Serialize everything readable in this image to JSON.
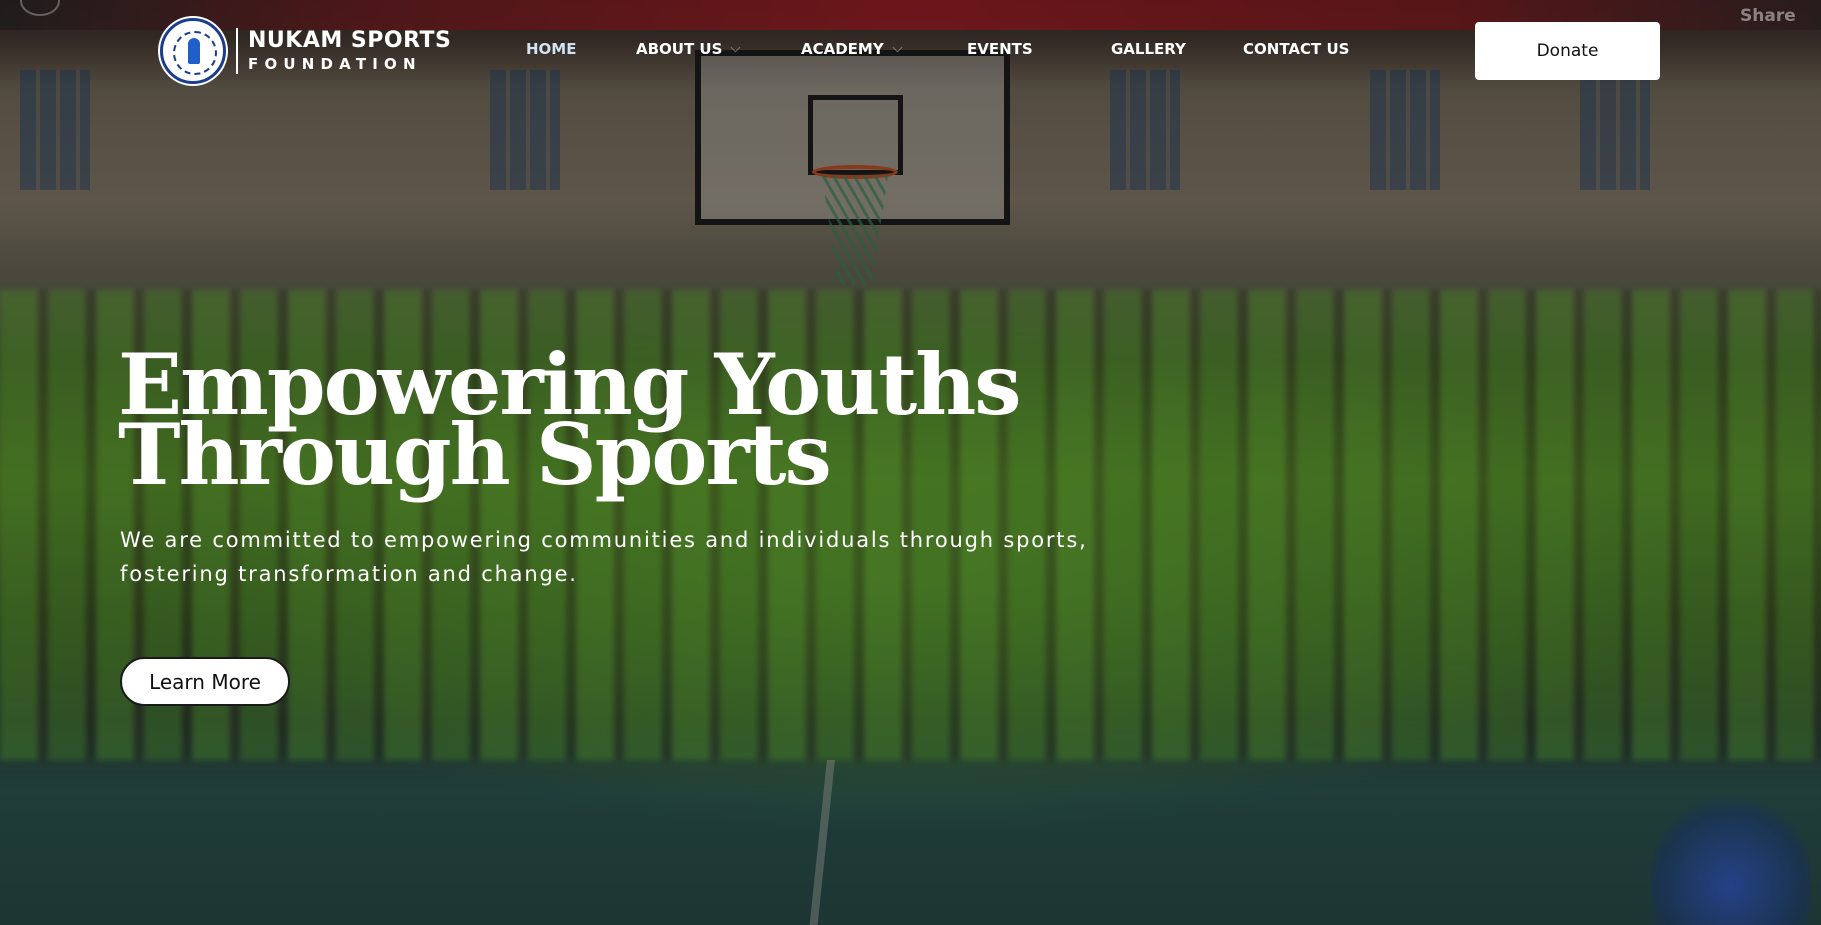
{
  "brand": {
    "name_line1": "NUKAM SPORTS",
    "name_line2": "FOUNDATION"
  },
  "nav": {
    "items": [
      {
        "label": "HOME",
        "active": true
      },
      {
        "label": "ABOUT US",
        "has_dropdown": true
      },
      {
        "label": "ACADEMY",
        "has_dropdown": true
      },
      {
        "label": "EVENTS"
      },
      {
        "label": "GALLERY"
      },
      {
        "label": "CONTACT US"
      }
    ]
  },
  "header": {
    "donate_label": "Donate",
    "share_label": "Share"
  },
  "hero": {
    "title_line1": "Empowering Youths",
    "title_line2": "Through Sports",
    "description": "We are committed to empowering communities and individuals through sports, fostering transformation and change.",
    "cta_label": "Learn More"
  },
  "colors": {
    "donate_bg": "#ffffff",
    "active_nav": "#cfe3f5",
    "logo_blue": "#1a3d8f"
  }
}
